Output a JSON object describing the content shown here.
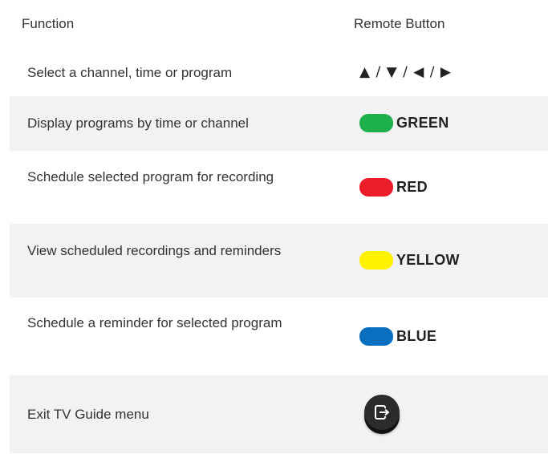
{
  "header": {
    "function_label": "Function",
    "button_label": "Remote Button"
  },
  "rows": [
    {
      "function": "Select a channel, time or program",
      "button_text": "▲ / ▼ / ◀ / ▶",
      "button_icon": "arrow-keys"
    },
    {
      "function": "Display programs by time or channel",
      "button_text": "GREEN",
      "button_color": "#1db04b"
    },
    {
      "function": "Schedule selected program for recording",
      "button_text": "RED",
      "button_color": "#ec1c2b"
    },
    {
      "function": "View scheduled recordings and reminders",
      "button_text": "YELLOW",
      "button_color": "#fff200"
    },
    {
      "function": "Schedule a reminder for selected program",
      "button_text": "BLUE",
      "button_color": "#0a6fbe"
    },
    {
      "function": "Exit TV Guide menu",
      "button_icon": "exit-icon"
    }
  ],
  "colors": {
    "shaded_row": "#f2f2f2",
    "text": "#333333"
  }
}
